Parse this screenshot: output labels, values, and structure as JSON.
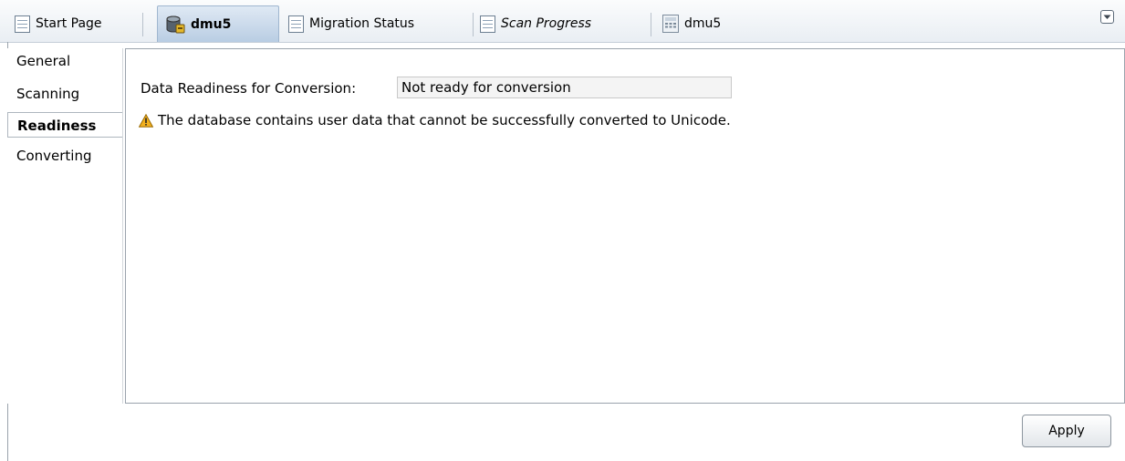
{
  "tabs": [
    {
      "label": "Start Page",
      "icon": "document-icon",
      "active": false,
      "italic": false
    },
    {
      "label": "dmu5",
      "icon": "database-connection-icon",
      "active": true,
      "italic": false
    },
    {
      "label": "Migration Status",
      "icon": "document-icon",
      "active": false,
      "italic": false
    },
    {
      "label": "Scan Progress",
      "icon": "document-icon",
      "active": false,
      "italic": true
    },
    {
      "label": "dmu5",
      "icon": "calculator-icon",
      "active": false,
      "italic": false
    }
  ],
  "nav": {
    "items": [
      {
        "label": "General"
      },
      {
        "label": "Scanning"
      },
      {
        "label": "Readiness",
        "selected": true
      },
      {
        "label": "Converting"
      }
    ]
  },
  "readiness": {
    "label": "Data Readiness for Conversion:",
    "value": "Not ready for conversion",
    "warning": "The database contains user data that cannot be successfully converted to Unicode."
  },
  "footer": {
    "apply_label": "Apply"
  },
  "colors": {
    "active_tab": "#c9d9ea",
    "warning": "#f2b01e"
  }
}
